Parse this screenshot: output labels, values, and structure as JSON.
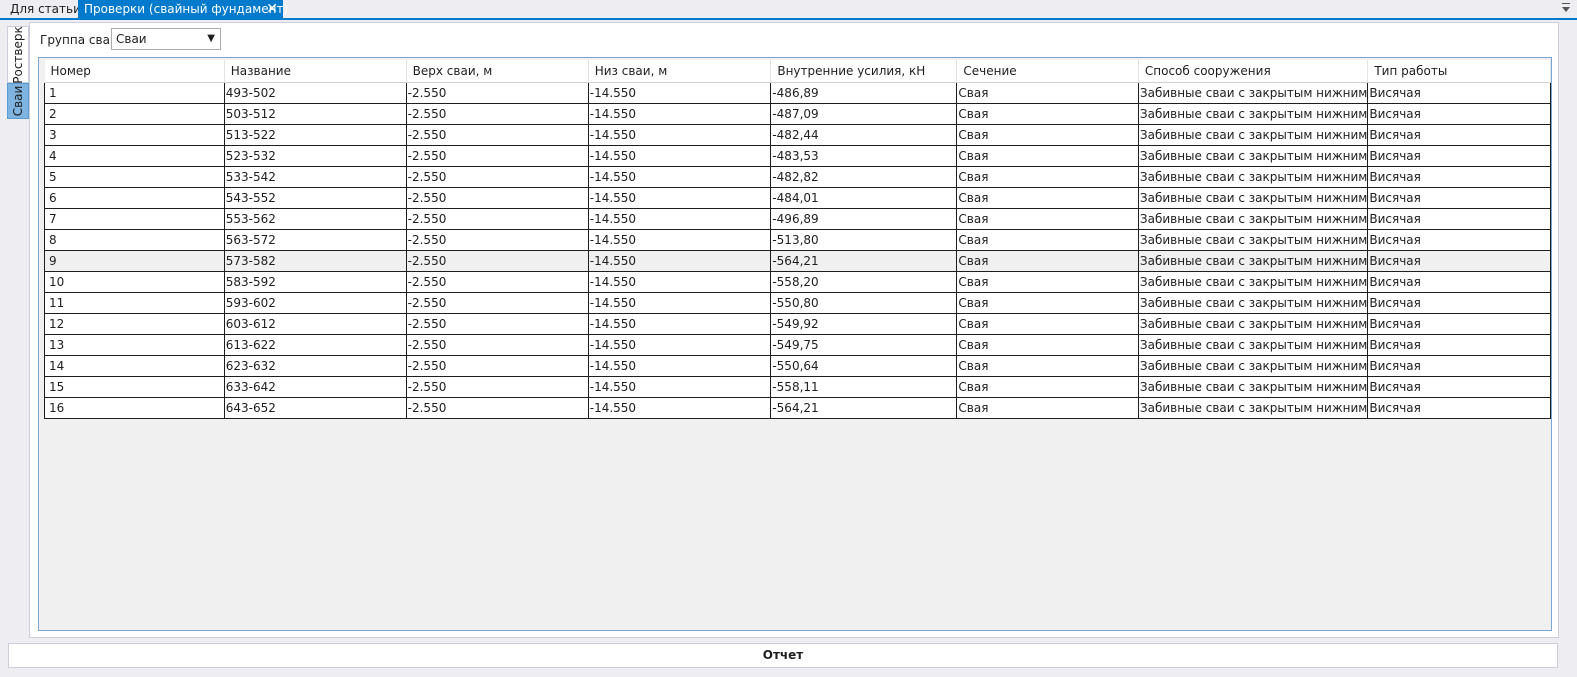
{
  "doc_tabs": [
    {
      "label": "Для статьи*"
    },
    {
      "label": "Проверки (свайный фундамент)"
    }
  ],
  "side_tabs": [
    {
      "label": "Ростверк"
    },
    {
      "label": "Сваи"
    }
  ],
  "filter": {
    "label": "Группа свай",
    "value": "Сваи"
  },
  "table": {
    "columns": [
      "Номер",
      "Название",
      "Верх сваи, м",
      "Низ сваи, м",
      "Внутренние усилия, кН",
      "Сечение",
      "Способ сооружения",
      "Тип работы"
    ],
    "rows": [
      [
        "1",
        "493-502",
        "-2.550",
        "-14.550",
        "-486,89",
        "Свая",
        "Забивные сваи с закрытым нижним",
        "Висячая"
      ],
      [
        "2",
        "503-512",
        "-2.550",
        "-14.550",
        "-487,09",
        "Свая",
        "Забивные сваи с закрытым нижним",
        "Висячая"
      ],
      [
        "3",
        "513-522",
        "-2.550",
        "-14.550",
        "-482,44",
        "Свая",
        "Забивные сваи с закрытым нижним",
        "Висячая"
      ],
      [
        "4",
        "523-532",
        "-2.550",
        "-14.550",
        "-483,53",
        "Свая",
        "Забивные сваи с закрытым нижним",
        "Висячая"
      ],
      [
        "5",
        "533-542",
        "-2.550",
        "-14.550",
        "-482,82",
        "Свая",
        "Забивные сваи с закрытым нижним",
        "Висячая"
      ],
      [
        "6",
        "543-552",
        "-2.550",
        "-14.550",
        "-484,01",
        "Свая",
        "Забивные сваи с закрытым нижним",
        "Висячая"
      ],
      [
        "7",
        "553-562",
        "-2.550",
        "-14.550",
        "-496,89",
        "Свая",
        "Забивные сваи с закрытым нижним",
        "Висячая"
      ],
      [
        "8",
        "563-572",
        "-2.550",
        "-14.550",
        "-513,80",
        "Свая",
        "Забивные сваи с закрытым нижним",
        "Висячая"
      ],
      [
        "9",
        "573-582",
        "-2.550",
        "-14.550",
        "-564,21",
        "Свая",
        "Забивные сваи с закрытым нижним",
        "Висячая"
      ],
      [
        "10",
        "583-592",
        "-2.550",
        "-14.550",
        "-558,20",
        "Свая",
        "Забивные сваи с закрытым нижним",
        "Висячая"
      ],
      [
        "11",
        "593-602",
        "-2.550",
        "-14.550",
        "-550,80",
        "Свая",
        "Забивные сваи с закрытым нижним",
        "Висячая"
      ],
      [
        "12",
        "603-612",
        "-2.550",
        "-14.550",
        "-549,92",
        "Свая",
        "Забивные сваи с закрытым нижним",
        "Висячая"
      ],
      [
        "13",
        "613-622",
        "-2.550",
        "-14.550",
        "-549,75",
        "Свая",
        "Забивные сваи с закрытым нижним",
        "Висячая"
      ],
      [
        "14",
        "623-632",
        "-2.550",
        "-14.550",
        "-550,64",
        "Свая",
        "Забивные сваи с закрытым нижним",
        "Висячая"
      ],
      [
        "15",
        "633-642",
        "-2.550",
        "-14.550",
        "-558,11",
        "Свая",
        "Забивные сваи с закрытым нижним",
        "Висячая"
      ],
      [
        "16",
        "643-652",
        "-2.550",
        "-14.550",
        "-564,21",
        "Свая",
        "Забивные сваи с закрытым нижним",
        "Висячая"
      ]
    ]
  },
  "report_button": {
    "label": "Отчет"
  },
  "colors": {
    "accent": "#007acc"
  }
}
